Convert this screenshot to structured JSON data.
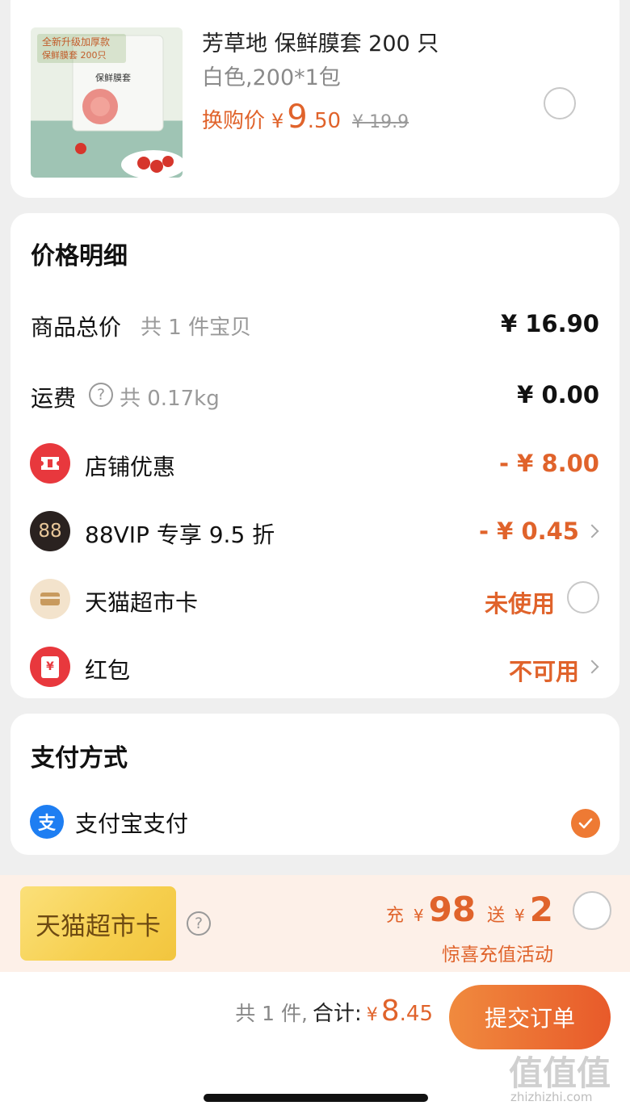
{
  "product": {
    "title": "芳草地 保鲜膜套 200 只",
    "spec": "白色,200*1包",
    "swap_label": "换购价",
    "currency": "¥",
    "price_int": "9",
    "price_dec": ".50",
    "original_price": "¥ 19.9",
    "image_badge_line1": "全新升级加厚款",
    "image_badge_line2": "保鲜膜套 200只",
    "image_bag_label": "保鲜膜套"
  },
  "price_detail": {
    "title": "价格明细",
    "goods_total_label": "商品总价",
    "goods_total_count": "共 1 件宝贝",
    "goods_total_value": "¥ 16.90",
    "shipping_label": "运费",
    "shipping_weight": "共 0.17kg",
    "shipping_value": "¥ 0.00",
    "store_discount_label": "店铺优惠",
    "store_discount_value": "- ¥ 8.00",
    "vip_label": "88VIP 专享 9.5 折",
    "vip_icon_text": "88",
    "vip_value": "- ¥ 0.45",
    "tmall_card_label": "天猫超市卡",
    "tmall_card_value": "未使用",
    "red_packet_label": "红包",
    "red_packet_icon_text": "¥",
    "red_packet_value": "不可用"
  },
  "payment": {
    "title": "支付方式",
    "method_label": "支付宝支付",
    "alipay_icon_text": "支"
  },
  "promo": {
    "badge_text": "天猫超市卡",
    "recharge_prefix": "充",
    "recharge_currency": "¥",
    "recharge_amount": "98",
    "gift_prefix": "送",
    "gift_currency": "¥",
    "gift_amount": "2",
    "subtitle": "惊喜充值活动"
  },
  "footer": {
    "count_text": "共 1 件,",
    "total_label": "合计:",
    "currency": "¥",
    "total_int": "8",
    "total_dec": ".45",
    "submit_label": "提交订单"
  },
  "watermark": {
    "logo_text": "值值值",
    "domain_text": "zhizhizhi.com"
  },
  "colors": {
    "accent_orange": "#e0632b",
    "alipay_blue": "#1e7ef2",
    "store_red": "#e8383d"
  }
}
